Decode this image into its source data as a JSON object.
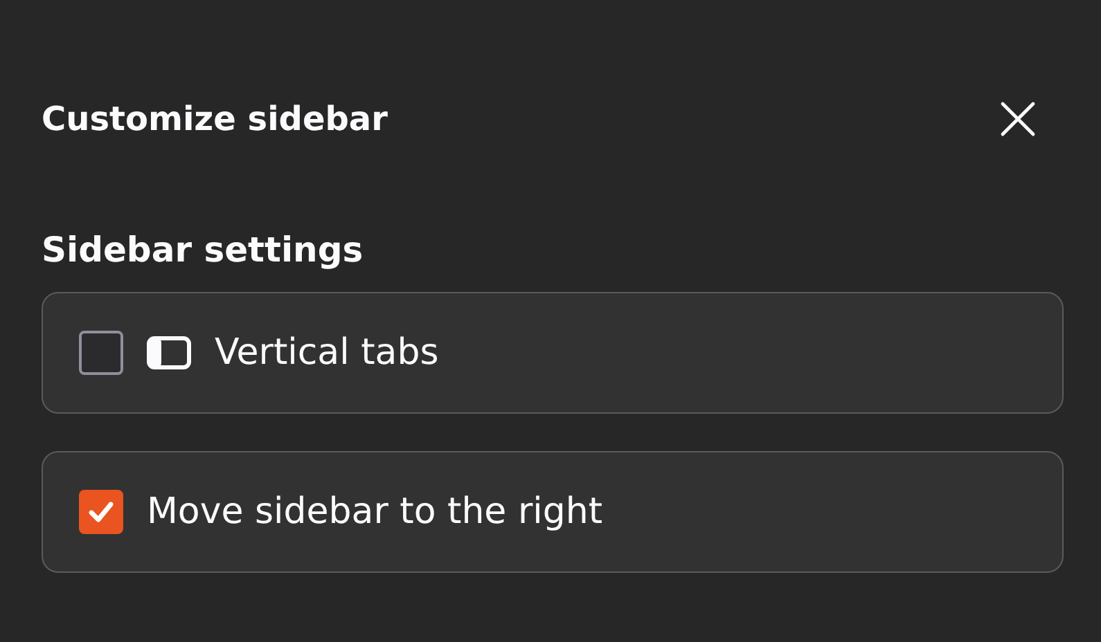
{
  "dialog": {
    "title": "Customize sidebar"
  },
  "section": {
    "heading": "Sidebar settings"
  },
  "options": [
    {
      "kind": "with-icon",
      "label": "Vertical tabs",
      "checked": false
    },
    {
      "kind": "plain",
      "label": "Move sidebar to the right",
      "checked": true
    }
  ]
}
